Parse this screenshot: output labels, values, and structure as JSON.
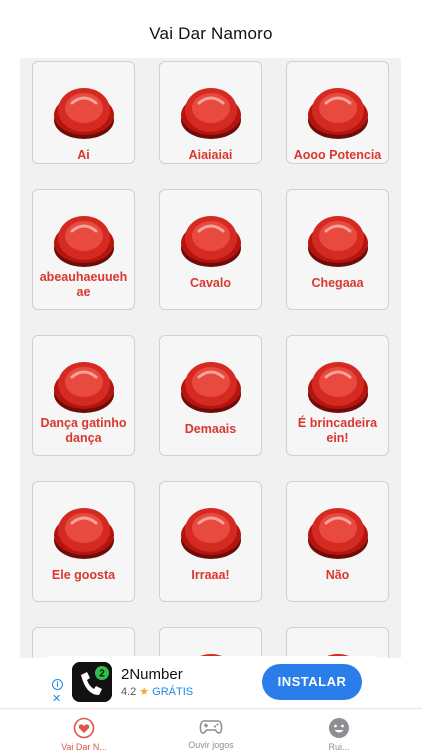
{
  "header": {
    "title": "Vai Dar Namoro"
  },
  "sounds": [
    {
      "label": "Ai"
    },
    {
      "label": "Aiaiaiai"
    },
    {
      "label": "Aooo Potencia"
    },
    {
      "label": "abeauhaeuueh ae"
    },
    {
      "label": "Cavalo"
    },
    {
      "label": "Chegaaa"
    },
    {
      "label": "Dança gatinho dança"
    },
    {
      "label": "Demaais"
    },
    {
      "label": "É brincadeira ein!"
    },
    {
      "label": "Ele goosta"
    },
    {
      "label": "Irraaa!"
    },
    {
      "label": "Não"
    },
    {
      "label": ""
    },
    {
      "label": ""
    },
    {
      "label": ""
    }
  ],
  "ad": {
    "app_name": "2Number",
    "rating": "4.2",
    "price": "GRÁTIS",
    "install_label": "INSTALAR",
    "info_icon": "info-icon",
    "close_icon": "close-icon"
  },
  "tabs": [
    {
      "label": "Vai Dar N...",
      "icon": "heart-icon",
      "active": true
    },
    {
      "label": "Ouvir jogos",
      "icon": "gamepad-icon",
      "active": false
    },
    {
      "label": "Rui...",
      "icon": "smiley-icon",
      "active": false
    }
  ],
  "colors": {
    "accent": "#e0554a",
    "label_red": "#d8382f",
    "button_red": "#c9201c",
    "install_blue": "#2b7de9"
  }
}
